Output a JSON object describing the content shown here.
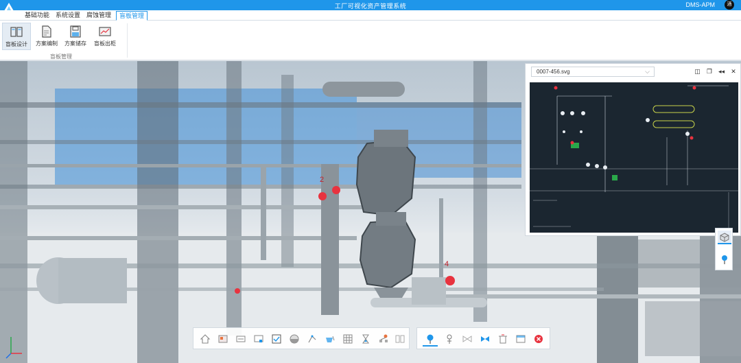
{
  "app": {
    "title": "工厂可视化资产管理系统",
    "brand": "DMS-APM",
    "avatar_text": "酒"
  },
  "tabs": [
    {
      "label": "基础功能"
    },
    {
      "label": "系统设置"
    },
    {
      "label": "腐蚀管理"
    },
    {
      "label": "盲板管理"
    }
  ],
  "ribbon": {
    "group_label": "盲板管理",
    "buttons": [
      {
        "label": "盲板设计"
      },
      {
        "label": "方案编制"
      },
      {
        "label": "方案储存"
      },
      {
        "label": "盲板出柜"
      }
    ]
  },
  "svg_panel": {
    "file_name": "0007-456.svg"
  },
  "scene_labels": {
    "marker_a": "2",
    "marker_b": "4"
  },
  "colors": {
    "accent": "#1f96ea",
    "marker_red": "#e8333f",
    "drawing_bg": "#1b2630"
  },
  "bottom_toolbar": {
    "left_icons": [
      "home-icon",
      "layers-icon",
      "map-icon",
      "screen-icon",
      "check-icon",
      "half-circle-icon",
      "measure-icon",
      "pour-icon",
      "grid-icon",
      "hourglass-icon",
      "network-icon",
      "book-icon"
    ],
    "right_icons": [
      "pin-icon",
      "valve-pin-icon",
      "blind-open-icon",
      "blind-close-icon",
      "trash-icon",
      "window-icon",
      "stop-icon"
    ]
  }
}
